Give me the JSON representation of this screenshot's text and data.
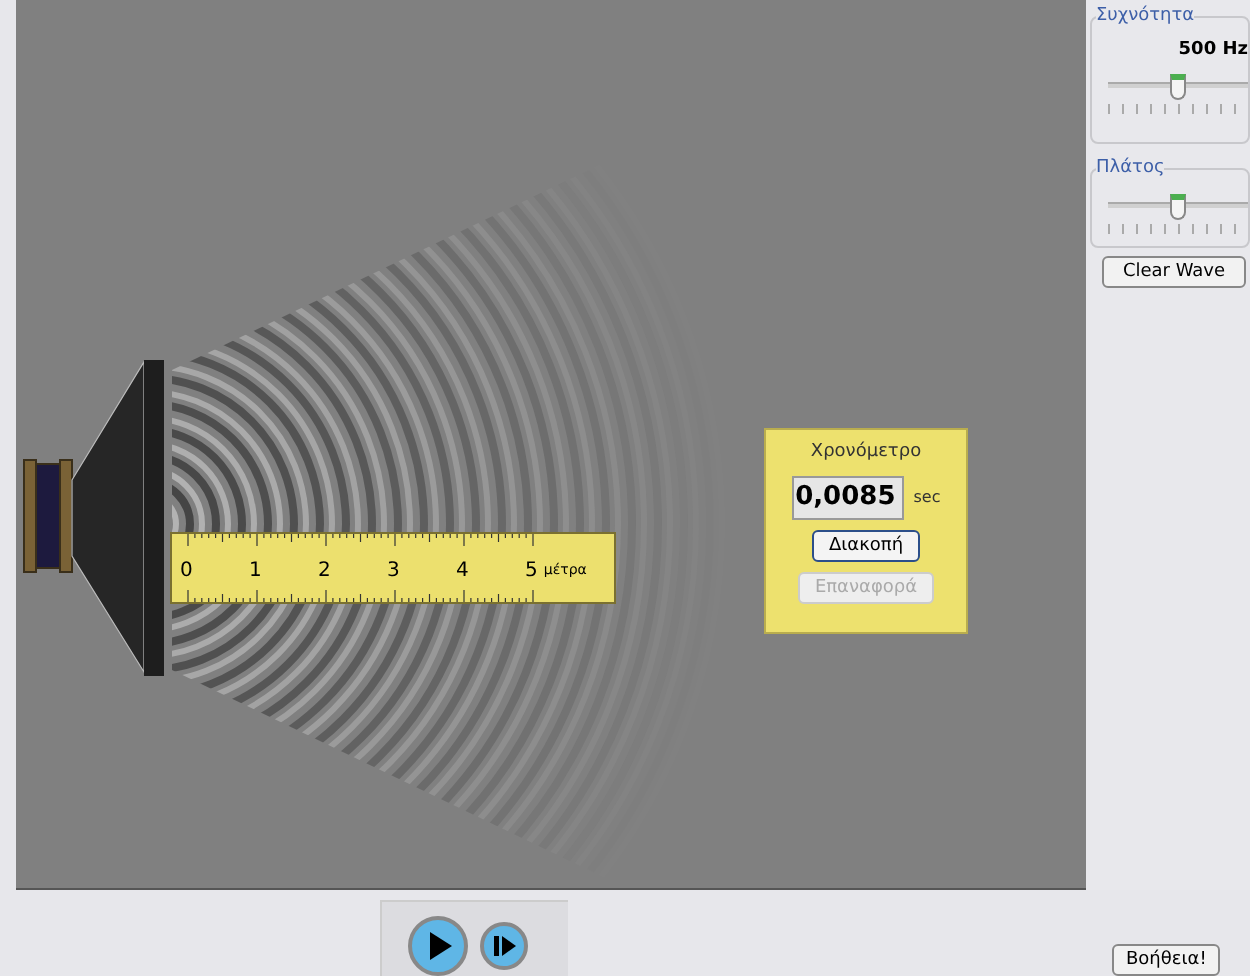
{
  "controls": {
    "frequency": {
      "label": "Συχνότητα",
      "reading": "500 Hz",
      "level": 0.5
    },
    "amplitude": {
      "label": "Πλάτος",
      "level": 0.5
    },
    "clear_button": "Clear Wave"
  },
  "ruler": {
    "numbers": [
      "0",
      "1",
      "2",
      "3",
      "4",
      "5"
    ],
    "unit": "μέτρα"
  },
  "stopwatch": {
    "title": "Χρονόμετρο",
    "time": "0,0085",
    "unit": "sec",
    "stop_button": {
      "label": "Διακοπή",
      "disabled": false
    },
    "reset_button": {
      "label": "Επαναφορά",
      "disabled": true
    }
  },
  "help_button": "Βοήθεια!"
}
